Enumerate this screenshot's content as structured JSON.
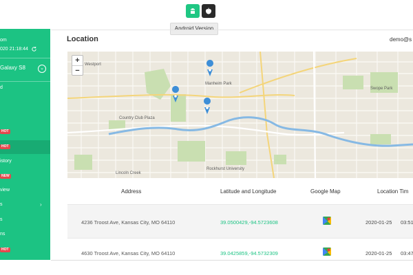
{
  "platform": {
    "tooltip": "Android Version",
    "active": "android"
  },
  "sidebar": {
    "account_name": "om",
    "last_sync": "020 21:18:44",
    "device_name": "Galaxy S8",
    "items": [
      {
        "label": "d"
      },
      {
        "label": ""
      },
      {
        "label": ""
      },
      {
        "label": "",
        "badge": "HOT"
      },
      {
        "label": "",
        "badge": "HOT"
      },
      {
        "label": "istory"
      },
      {
        "label": "",
        "badge": "NEW"
      },
      {
        "label": "view"
      },
      {
        "label": "s"
      },
      {
        "label": "s"
      },
      {
        "label": "ns"
      },
      {
        "label": "",
        "badge": "HOT"
      }
    ]
  },
  "header": {
    "title": "Location",
    "user": "demo@s"
  },
  "map": {
    "zoom_in": "+",
    "zoom_out": "−",
    "labels": [
      "Westport",
      "Country Club Plaza",
      "Manheim Park",
      "Rockhurst University",
      "Lincoln Creek",
      "Swope Park"
    ],
    "pins": 3
  },
  "table": {
    "headers": [
      "Address",
      "Latitude and Longitude",
      "Google Map",
      "Location Time"
    ],
    "header_display": [
      "Address",
      "Latitude and Longitude",
      "Google Map",
      "Location Tim"
    ],
    "rows": [
      {
        "address": "4236 Troost Ave, Kansas City, MO 64110",
        "coords": "39.0500429,-94.5723608",
        "date": "2020-01-25",
        "time": "03:51:"
      },
      {
        "address": "4630 Troost Ave, Kansas City, MO 64110",
        "coords": "39.0425859,-94.5732309",
        "date": "2020-01-25",
        "time": "03:47:"
      }
    ]
  },
  "colors": {
    "accent": "#1cc383",
    "link": "#1cc383",
    "hot_badge": "#e5484d",
    "ios_button": "#2a2a2a"
  }
}
